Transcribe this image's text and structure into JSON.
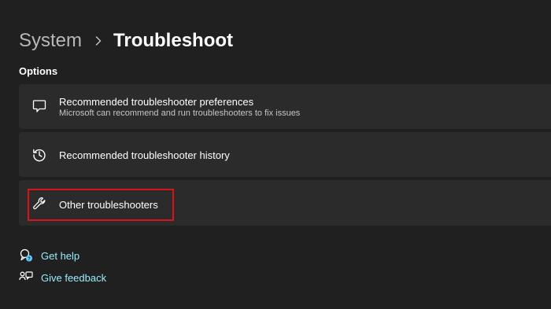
{
  "breadcrumb": {
    "parent": "System",
    "current": "Troubleshoot"
  },
  "options": {
    "section_label": "Options",
    "items": [
      {
        "title": "Recommended troubleshooter preferences",
        "subtitle": "Microsoft can recommend and run troubleshooters to fix issues",
        "icon": "chat-bubble-icon"
      },
      {
        "title": "Recommended troubleshooter history",
        "icon": "history-icon"
      },
      {
        "title": "Other troubleshooters",
        "icon": "wrench-icon",
        "highlighted": true
      }
    ]
  },
  "links": [
    {
      "label": "Get help",
      "icon": "get-help-icon"
    },
    {
      "label": "Give feedback",
      "icon": "feedback-icon"
    }
  ],
  "colors": {
    "background": "#202020",
    "card": "#2b2b2b",
    "link": "#99ebff",
    "highlight": "#d7141a",
    "help_badge": "#60cdff"
  }
}
